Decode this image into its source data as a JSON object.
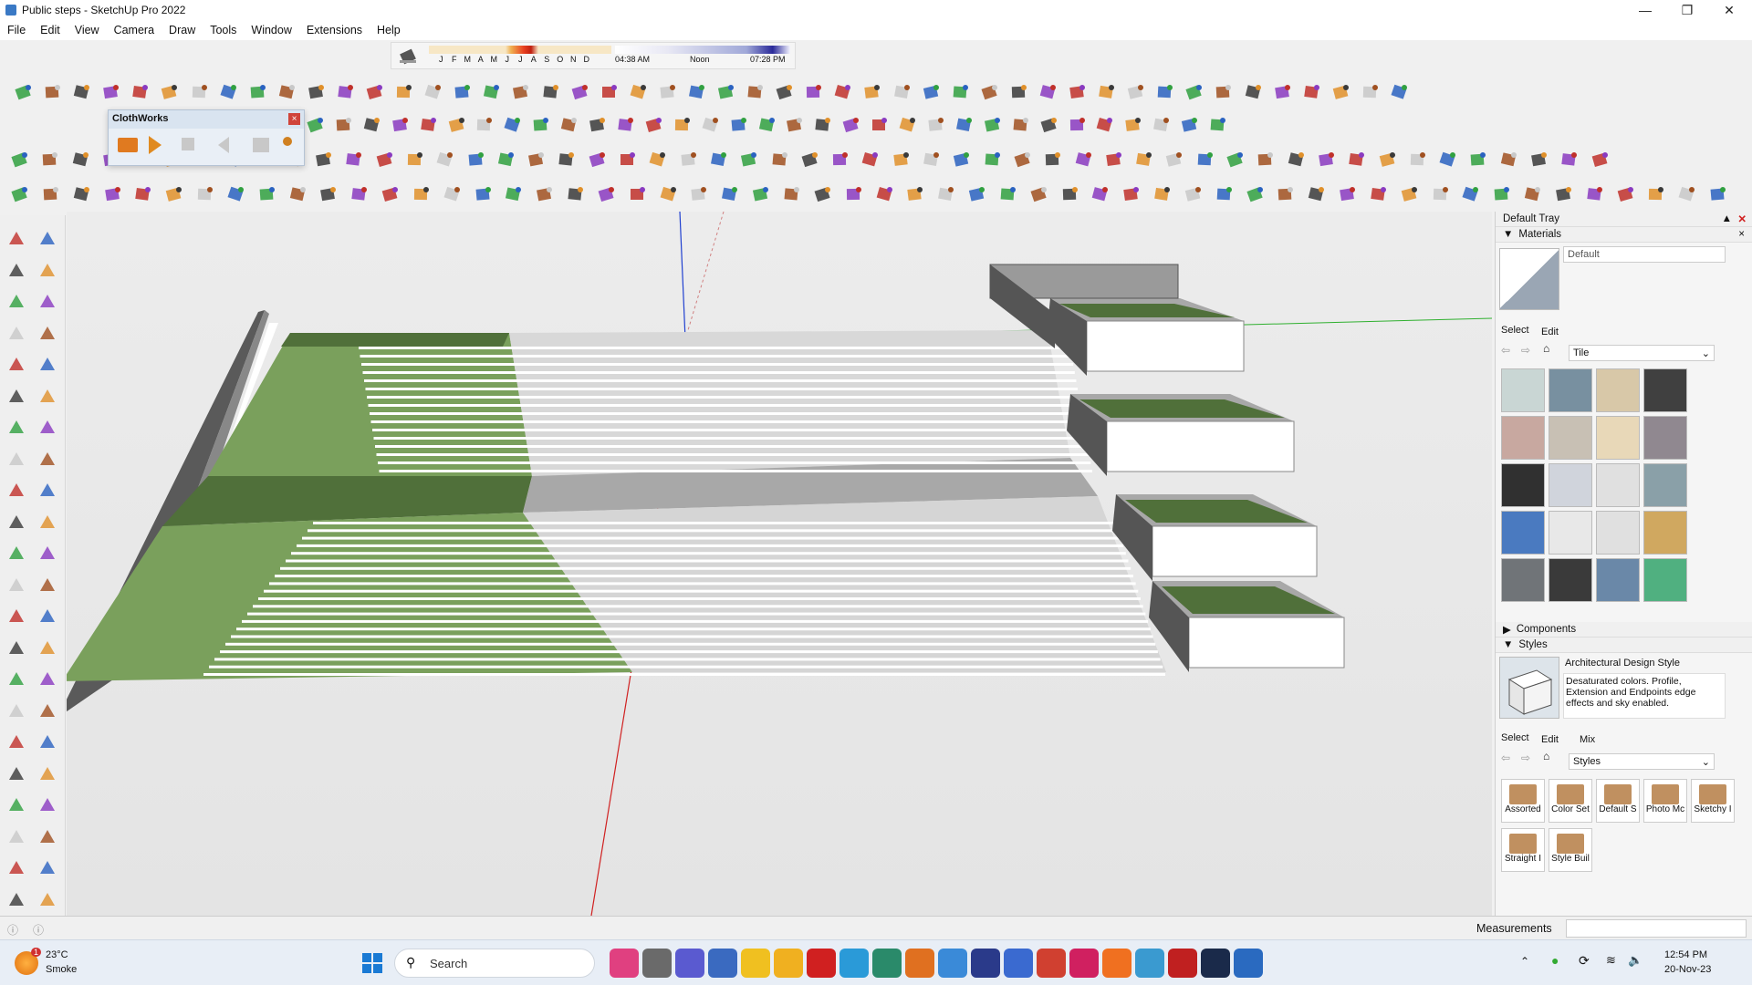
{
  "window": {
    "title": "Public steps - SketchUp Pro 2022"
  },
  "menu": [
    "File",
    "Edit",
    "View",
    "Camera",
    "Draw",
    "Tools",
    "Window",
    "Extensions",
    "Help"
  ],
  "shadow": {
    "months": [
      "J",
      "F",
      "M",
      "A",
      "M",
      "J",
      "J",
      "A",
      "S",
      "O",
      "N",
      "D"
    ],
    "sunrise": "04:38 AM",
    "noon": "Noon",
    "sunset": "07:28 PM"
  },
  "clothworks": {
    "title": "ClothWorks"
  },
  "tray": {
    "title": "Default Tray",
    "materials": {
      "header": "Materials",
      "current": "Default",
      "tabs": [
        "Select",
        "Edit"
      ],
      "collection": "Tile"
    },
    "components": {
      "header": "Components"
    },
    "styles": {
      "header": "Styles",
      "current_name": "Architectural Design Style",
      "description": "Desaturated colors. Profile, Extension and Endpoints edge effects and sky enabled.",
      "tabs": [
        "Select",
        "Edit",
        "Mix"
      ],
      "collection": "Styles",
      "folders": [
        "Assorted",
        "Color Set",
        "Default S",
        "Photo Mc",
        "Sketchy I",
        "Straight I",
        "Style Buil"
      ]
    }
  },
  "status": {
    "measurements": "Measurements"
  },
  "taskbar": {
    "weather_temp": "23°C",
    "weather_desc": "Smoke",
    "weather_badge": "1",
    "search": "Search",
    "time": "12:54 PM",
    "date": "20-Nov-23"
  },
  "colors": {
    "accent_green": "#6e8f52",
    "axis_blue": "#2040d0",
    "axis_red": "#d02020",
    "axis_green": "#30b030"
  }
}
